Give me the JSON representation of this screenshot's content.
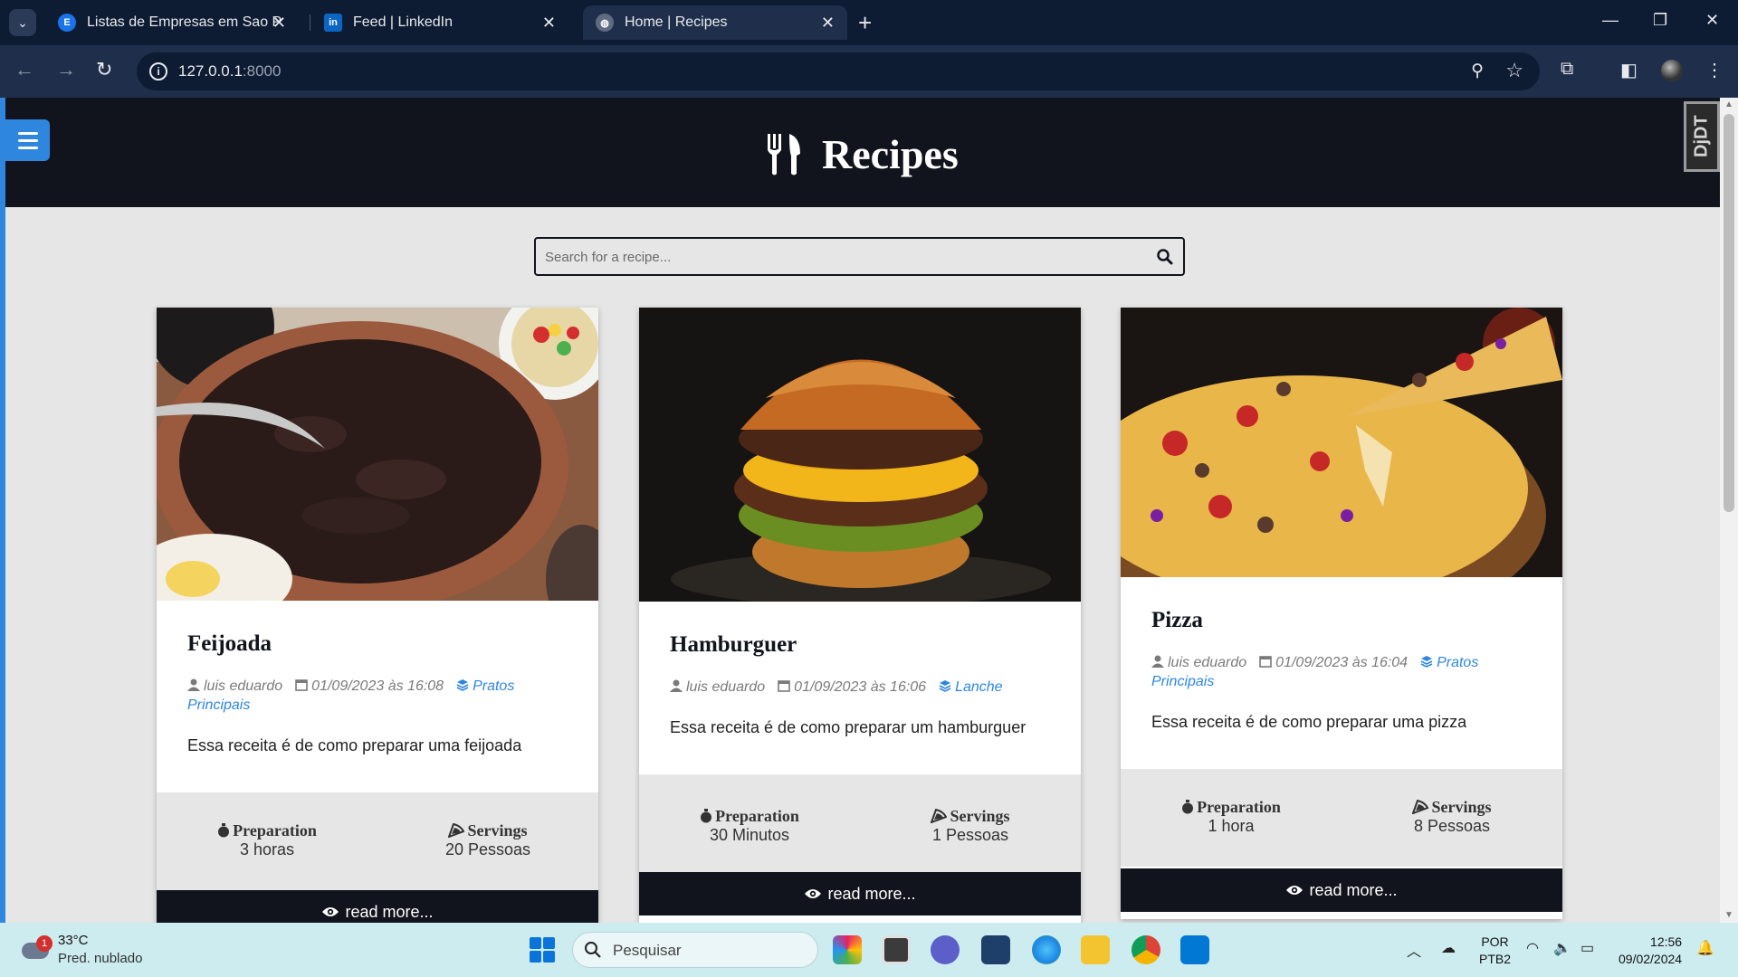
{
  "browser": {
    "tabs": [
      {
        "title": "Listas de Empresas em Sao Paulo",
        "icon": "empresas-favicon",
        "active": false
      },
      {
        "title": "Feed | LinkedIn",
        "icon": "linkedin-favicon",
        "active": false
      },
      {
        "title": "Home | Recipes",
        "icon": "globe-favicon",
        "active": true
      }
    ],
    "url_host": "127.0.0.1",
    "url_port": ":8000"
  },
  "site": {
    "brand": "Recipes",
    "search_placeholder": "Search for a recipe...",
    "debug_toolbar": "DjDT"
  },
  "recipes": [
    {
      "title": "Feijoada",
      "author": "luis eduardo",
      "date": "01/09/2023 às 16:08",
      "category": "Pratos Principais",
      "description": "Essa receita é de como preparar uma feijoada",
      "prep_label": "Preparation",
      "prep_value": "3 horas",
      "serv_label": "Servings",
      "serv_value": "20 Pessoas",
      "read_more": "read more..."
    },
    {
      "title": "Hamburguer",
      "author": "luis eduardo",
      "date": "01/09/2023 às 16:06",
      "category": "Lanche",
      "description": "Essa receita é de como preparar um hamburguer",
      "prep_label": "Preparation",
      "prep_value": "30 Minutos",
      "serv_label": "Servings",
      "serv_value": "1 Pessoas",
      "read_more": "read more..."
    },
    {
      "title": "Pizza",
      "author": "luis eduardo",
      "date": "01/09/2023 às 16:04",
      "category": "Pratos Principais",
      "description": "Essa receita é de como preparar uma pizza",
      "prep_label": "Preparation",
      "prep_value": "1 hora",
      "serv_label": "Servings",
      "serv_value": "8 Pessoas",
      "read_more": "read more..."
    }
  ],
  "taskbar": {
    "weather_badge": "1",
    "temperature": "33°C",
    "condition": "Pred. nublado",
    "search_label": "Pesquisar",
    "lang_top": "POR",
    "lang_bottom": "PTB2",
    "time": "12:56",
    "date": "09/02/2024"
  },
  "colors": {
    "accent": "#2e86de",
    "header_bg": "#12141d",
    "page_bg": "#e6e6e6"
  }
}
